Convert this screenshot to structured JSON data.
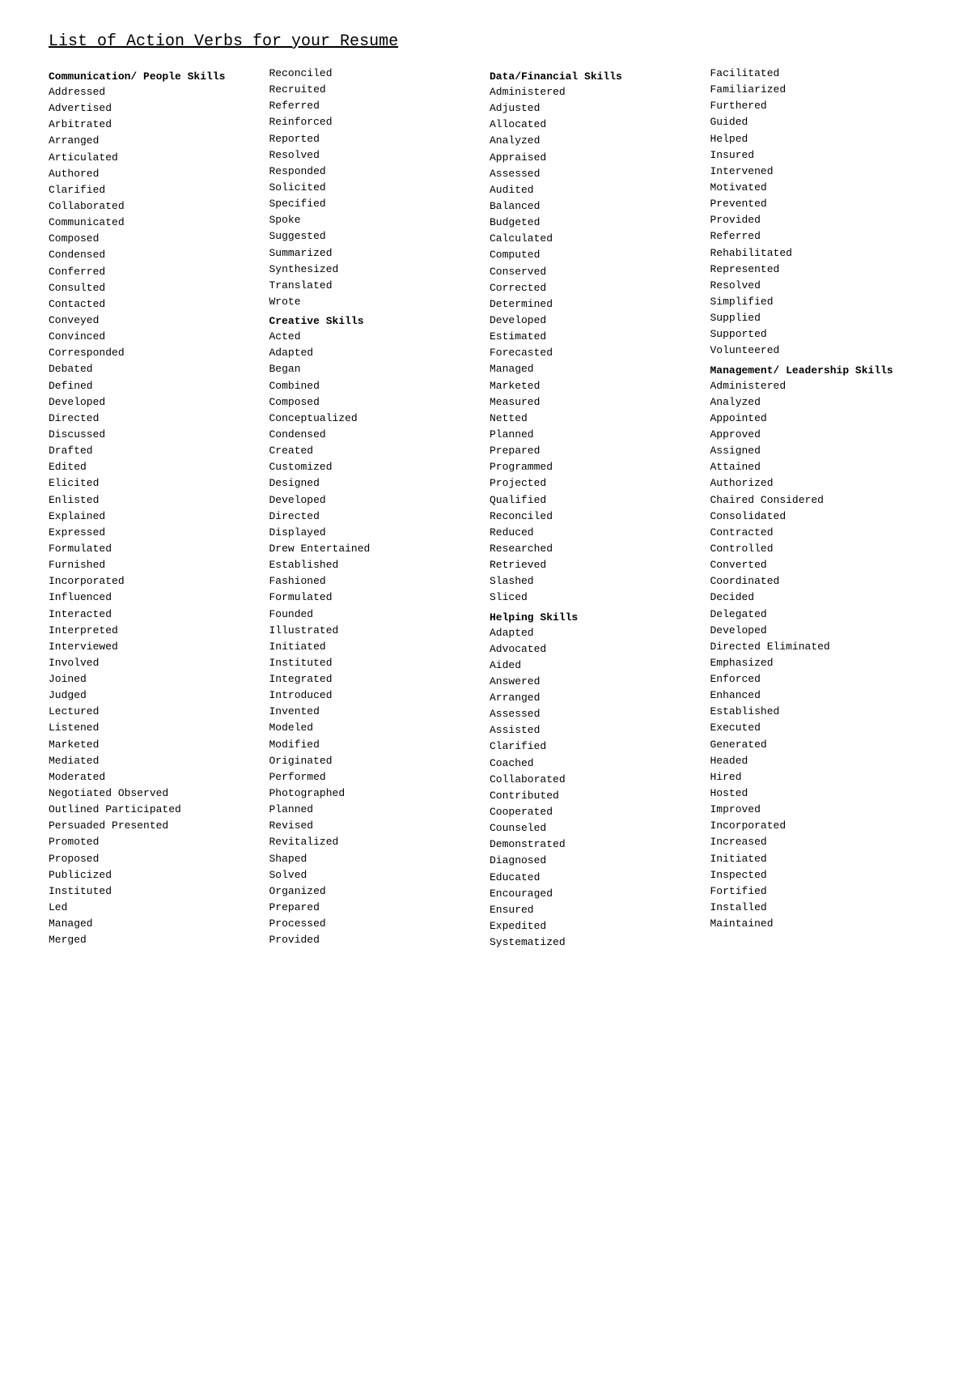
{
  "title": "List of Action Verbs for your Resume",
  "columns": [
    {
      "id": "col1",
      "sections": [
        {
          "header": "Communication/ People Skills",
          "headerBold": true,
          "words": [
            "Addressed",
            "Advertised",
            "Arbitrated",
            "Arranged",
            "Articulated",
            "Authored",
            "Clarified",
            "Collaborated",
            "Communicated",
            "Composed",
            "Condensed",
            "Conferred",
            "Consulted",
            "Contacted",
            "Conveyed",
            "Convinced",
            "Corresponded",
            "Debated",
            "Defined",
            "Developed",
            "Directed",
            "Discussed",
            "Drafted",
            "Edited",
            "Elicited",
            "Enlisted",
            "Explained",
            "Expressed",
            "Formulated",
            "Furnished",
            "Incorporated",
            "Influenced",
            "Interacted",
            "Interpreted",
            "Interviewed",
            "Involved",
            "Joined",
            "Judged",
            "Lectured",
            "Listened",
            "Marketed",
            "Mediated",
            "Moderated",
            "Negotiated Observed",
            "Outlined Participated",
            "Persuaded Presented",
            "Promoted",
            "Proposed",
            "Publicized",
            "Instituted",
            "Led",
            "Managed",
            "Merged"
          ]
        }
      ]
    },
    {
      "id": "col2",
      "sections": [
        {
          "header": null,
          "words": [
            "Reconciled",
            "Recruited",
            "Referred",
            "Reinforced",
            "Reported",
            "Resolved",
            "Responded",
            "Solicited",
            "Specified",
            "Spoke",
            "Suggested",
            "Summarized",
            "Synthesized",
            "Translated",
            "Wrote"
          ]
        },
        {
          "header": "Creative Skills",
          "headerBold": true,
          "words": [
            "Acted",
            "Adapted",
            "Began",
            "Combined",
            "Composed",
            "Conceptualized",
            "Condensed",
            "Created",
            "Customized",
            "Designed",
            "Developed",
            "Directed",
            "Displayed",
            "Drew Entertained",
            "Established",
            "Fashioned",
            "Formulated",
            "Founded",
            "Illustrated",
            "Initiated",
            "Instituted",
            "Integrated",
            "Introduced",
            "Invented",
            "Modeled",
            "Modified",
            "Originated",
            "Performed",
            "Photographed",
            "Planned",
            "Revised",
            "Revitalized",
            "Shaped",
            "Solved",
            "Organized",
            "Prepared",
            "Processed",
            "Provided"
          ]
        }
      ]
    },
    {
      "id": "col3",
      "sections": [
        {
          "header": "Data/Financial Skills",
          "headerBold": true,
          "words": [
            "Administered",
            "Adjusted",
            "Allocated",
            "Analyzed",
            "Appraised",
            "Assessed",
            "Audited",
            "Balanced",
            "Budgeted",
            "Calculated",
            "Computed",
            "Conserved",
            "Corrected",
            "Determined",
            "Developed",
            "Estimated",
            "Forecasted",
            "Managed",
            "Marketed",
            "Measured",
            "Netted",
            "Planned",
            "Prepared",
            "Programmed",
            "Projected",
            "Qualified",
            "Reconciled",
            "Reduced",
            "Researched",
            "Retrieved",
            "Slashed",
            "Sliced"
          ]
        },
        {
          "header": "Helping Skills",
          "headerBold": true,
          "words": [
            "Adapted",
            "Advocated",
            "Aided",
            "Answered",
            "Arranged",
            "Assessed",
            "Assisted",
            "Clarified",
            "Coached",
            "Collaborated",
            "Contributed",
            "Cooperated",
            "Counseled",
            "Demonstrated",
            "Diagnosed",
            "Educated",
            "Encouraged",
            "Ensured",
            "Expedited",
            "Systematized"
          ]
        }
      ]
    },
    {
      "id": "col4",
      "sections": [
        {
          "header": null,
          "words": [
            "Facilitated",
            "Familiarized",
            "Furthered",
            "Guided",
            "Helped",
            "Insured",
            "Intervened",
            "Motivated",
            "Prevented",
            "Provided",
            "Referred",
            "Rehabilitated",
            "Represented",
            "Resolved",
            "Simplified",
            "Supplied",
            "Supported",
            "Volunteered"
          ]
        },
        {
          "header": "Management/ Leadership Skills",
          "headerBold": true,
          "words": [
            "Administered",
            "Analyzed",
            "Appointed",
            "Approved",
            "Assigned",
            "Attained",
            "Authorized",
            "Chaired Considered",
            "Consolidated",
            "Contracted",
            "Controlled",
            "Converted",
            "Coordinated",
            "Decided",
            "Delegated",
            "Developed",
            "Directed Eliminated",
            "Emphasized",
            "Enforced",
            "Enhanced",
            "Established",
            "Executed",
            "Generated",
            "Headed",
            "Hired",
            "Hosted",
            "Improved",
            "Incorporated",
            "Increased",
            "Initiated",
            "Inspected",
            "Fortified",
            "Installed",
            "Maintained"
          ]
        }
      ]
    }
  ]
}
